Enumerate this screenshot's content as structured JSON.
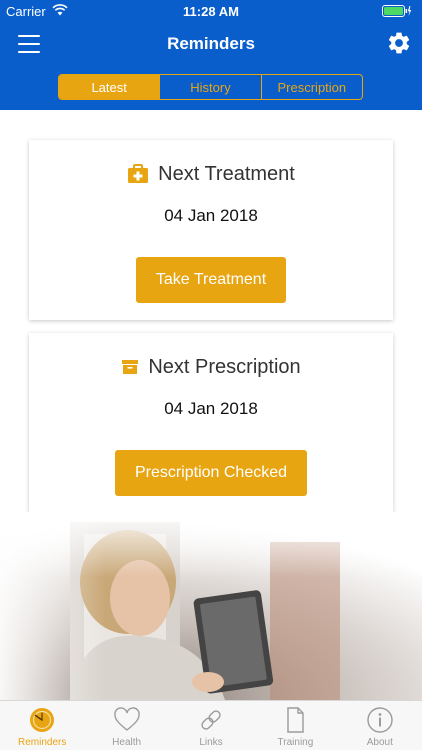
{
  "status_bar": {
    "carrier": "Carrier",
    "time": "11:28 AM"
  },
  "navbar": {
    "title": "Reminders"
  },
  "segments": [
    {
      "label": "Latest",
      "active": true
    },
    {
      "label": "History",
      "active": false
    },
    {
      "label": "Prescription",
      "active": false
    }
  ],
  "cards": [
    {
      "icon": "first-aid-kit-icon",
      "title": "Next Treatment",
      "date": "04 Jan 2018",
      "button_label": "Take Treatment"
    },
    {
      "icon": "archive-box-icon",
      "title": "Next Prescription",
      "date": "04 Jan 2018",
      "button_label": "Prescription Checked"
    }
  ],
  "tabbar": {
    "items": [
      {
        "label": "Reminders",
        "icon": "clock-icon",
        "active": true
      },
      {
        "label": "Health",
        "icon": "heart-icon",
        "active": false
      },
      {
        "label": "Links",
        "icon": "link-icon",
        "active": false
      },
      {
        "label": "Training",
        "icon": "document-icon",
        "active": false
      },
      {
        "label": "About",
        "icon": "info-icon",
        "active": false
      }
    ]
  },
  "colors": {
    "header_blue": "#0a5ecb",
    "accent_amber": "#e8a512",
    "tab_inactive": "#9b9b9b"
  }
}
